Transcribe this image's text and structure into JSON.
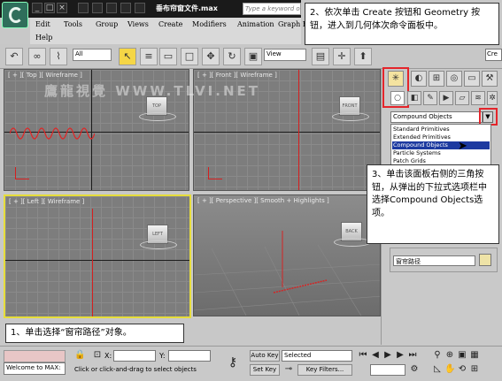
{
  "window": {
    "title": "垂布帘窗文件.max",
    "search_placeholder": "Type a keyword or",
    "controls": [
      "_",
      "□",
      "×"
    ]
  },
  "menu": [
    "Edit",
    "Tools",
    "Group",
    "Views",
    "Create",
    "Modifiers",
    "Animation",
    "Graph E",
    "Help"
  ],
  "toolbar": {
    "selection_filter": "All",
    "ref_coord": "View",
    "partial_label": "Cre"
  },
  "viewports": [
    {
      "label": "[ + ][ Top ][ Wireframe ]",
      "cube": "TOP"
    },
    {
      "label": "[ + ][ Front ][ Wireframe ]",
      "cube": "FRONT"
    },
    {
      "label": "[ + ][ Left ][ Wireframe ]",
      "cube": "LEFT"
    },
    {
      "label": "[ + ][ Perspective ][ Smooth + Highlights ]",
      "cube": "BACK"
    }
  ],
  "watermark": "鷹龍視覺 WWW.TLVI.NET",
  "command_panel": {
    "category_selected": "Compound Objects",
    "category_options": [
      "Standard Primitives",
      "Extended Primitives",
      "Compound Objects",
      "Particle Systems",
      "Patch Grids"
    ],
    "object_name": "窗帘路径"
  },
  "callouts": {
    "step1": "1、单击选择“窗帘路径”对象。",
    "step2": "2、依次单击 Create 按钮和 Geometry 按钮，进入到几何体次命令面板中。",
    "step3": "3、单击该面板右侧的三角按钮，从弹出的下拉式选项栏中选择Compound Objects选项。"
  },
  "status": {
    "welcome": "Welcome to MAX:",
    "x_label": "X:",
    "y_label": "Y:",
    "prompt": "Click or click-and-drag to select objects",
    "auto_key": "Auto Key",
    "set_key": "Set Key",
    "key_mode": "Selected",
    "key_filters": "Key Filters..."
  }
}
